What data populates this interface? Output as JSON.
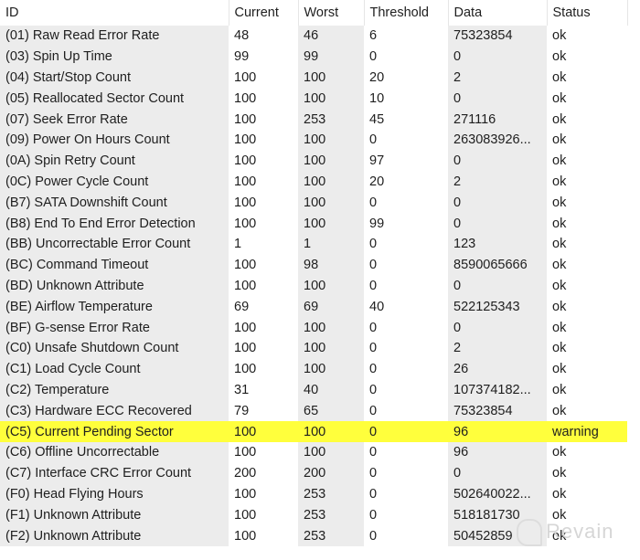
{
  "columns": [
    "ID",
    "Current",
    "Worst",
    "Threshold",
    "Data",
    "Status"
  ],
  "rows": [
    [
      "(01) Raw Read Error Rate",
      "48",
      "46",
      "6",
      "75323854",
      "ok"
    ],
    [
      "(03) Spin Up Time",
      "99",
      "99",
      "0",
      "0",
      "ok"
    ],
    [
      "(04) Start/Stop Count",
      "100",
      "100",
      "20",
      "2",
      "ok"
    ],
    [
      "(05) Reallocated Sector Count",
      "100",
      "100",
      "10",
      "0",
      "ok"
    ],
    [
      "(07) Seek Error Rate",
      "100",
      "253",
      "45",
      "271116",
      "ok"
    ],
    [
      "(09) Power On Hours Count",
      "100",
      "100",
      "0",
      "263083926...",
      "ok"
    ],
    [
      "(0A) Spin Retry Count",
      "100",
      "100",
      "97",
      "0",
      "ok"
    ],
    [
      "(0C) Power Cycle Count",
      "100",
      "100",
      "20",
      "2",
      "ok"
    ],
    [
      "(B7) SATA Downshift Count",
      "100",
      "100",
      "0",
      "0",
      "ok"
    ],
    [
      "(B8) End To End Error Detection",
      "100",
      "100",
      "99",
      "0",
      "ok"
    ],
    [
      "(BB) Uncorrectable Error Count",
      "1",
      "1",
      "0",
      "123",
      "ok"
    ],
    [
      "(BC) Command Timeout",
      "100",
      "98",
      "0",
      "8590065666",
      "ok"
    ],
    [
      "(BD) Unknown Attribute",
      "100",
      "100",
      "0",
      "0",
      "ok"
    ],
    [
      "(BE) Airflow Temperature",
      "69",
      "69",
      "40",
      "522125343",
      "ok"
    ],
    [
      "(BF) G-sense Error Rate",
      "100",
      "100",
      "0",
      "0",
      "ok"
    ],
    [
      "(C0) Unsafe Shutdown Count",
      "100",
      "100",
      "0",
      "2",
      "ok"
    ],
    [
      "(C1) Load Cycle Count",
      "100",
      "100",
      "0",
      "26",
      "ok"
    ],
    [
      "(C2) Temperature",
      "31",
      "40",
      "0",
      "107374182...",
      "ok"
    ],
    [
      "(C3) Hardware ECC Recovered",
      "79",
      "65",
      "0",
      "75323854",
      "ok"
    ],
    [
      "(C5) Current Pending Sector",
      "100",
      "100",
      "0",
      "96",
      "warning"
    ],
    [
      "(C6) Offline Uncorrectable",
      "100",
      "100",
      "0",
      "96",
      "ok"
    ],
    [
      "(C7) Interface CRC Error Count",
      "200",
      "200",
      "0",
      "0",
      "ok"
    ],
    [
      "(F0) Head Flying Hours",
      "100",
      "253",
      "0",
      "502640022...",
      "ok"
    ],
    [
      "(F1) Unknown Attribute",
      "100",
      "253",
      "0",
      "518181730",
      "ok"
    ],
    [
      "(F2) Unknown Attribute",
      "100",
      "253",
      "0",
      "50452859",
      "ok"
    ]
  ],
  "highlight_color": "#ffff3c",
  "watermark": "Revain"
}
